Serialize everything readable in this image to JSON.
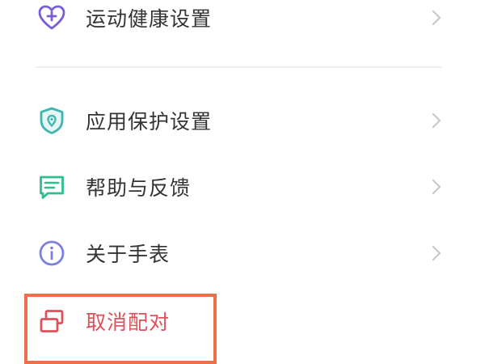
{
  "settings": {
    "items": [
      {
        "label": "运动健康设置",
        "icon": "heart-plus-icon",
        "icon_color": "#7b5cd6"
      },
      {
        "label": "应用保护设置",
        "icon": "shield-location-icon",
        "icon_color": "#3fb7b0"
      },
      {
        "label": "帮助与反馈",
        "icon": "chat-bubble-icon",
        "icon_color": "#2fbf8a"
      },
      {
        "label": "关于手表",
        "icon": "info-icon",
        "icon_color": "#7b7fe0"
      }
    ],
    "unpair": {
      "label": "取消配对",
      "icon": "unpair-icon",
      "icon_color": "#e0505a"
    }
  },
  "colors": {
    "text": "#333333",
    "danger": "#e0505a",
    "divider": "#eeeeee",
    "chevron": "#c8c8c8",
    "highlight_border": "#ee7048"
  }
}
